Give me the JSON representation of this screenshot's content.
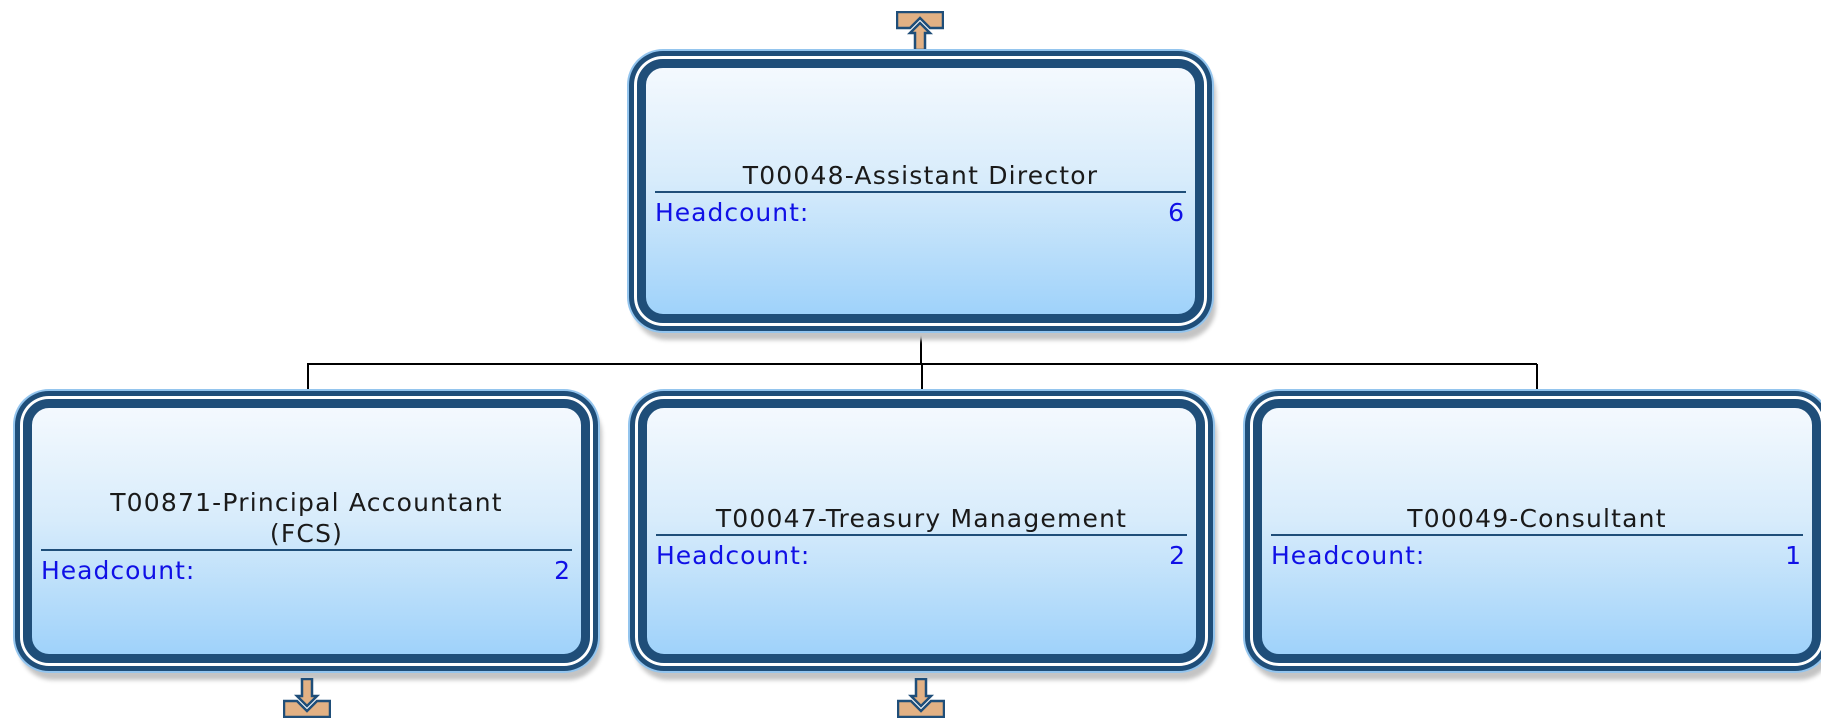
{
  "colors": {
    "border": "#1f4e79",
    "title_text": "#1a1a1a",
    "metric_text": "#1010e6",
    "arrow_fill": "#e2b184",
    "connector": "#000000"
  },
  "root": {
    "title": "T00048-Assistant Director",
    "metric_label": "Headcount:",
    "metric_value": "6",
    "has_up_arrow": true
  },
  "children": [
    {
      "title": "T00871-Principal Accountant (FCS)",
      "metric_label": "Headcount:",
      "metric_value": "2",
      "has_down_arrow": true
    },
    {
      "title": "T00047-Treasury Management",
      "metric_label": "Headcount:",
      "metric_value": "2",
      "has_down_arrow": true
    },
    {
      "title": "T00049-Consultant",
      "metric_label": "Headcount:",
      "metric_value": "1",
      "has_down_arrow": false
    }
  ]
}
